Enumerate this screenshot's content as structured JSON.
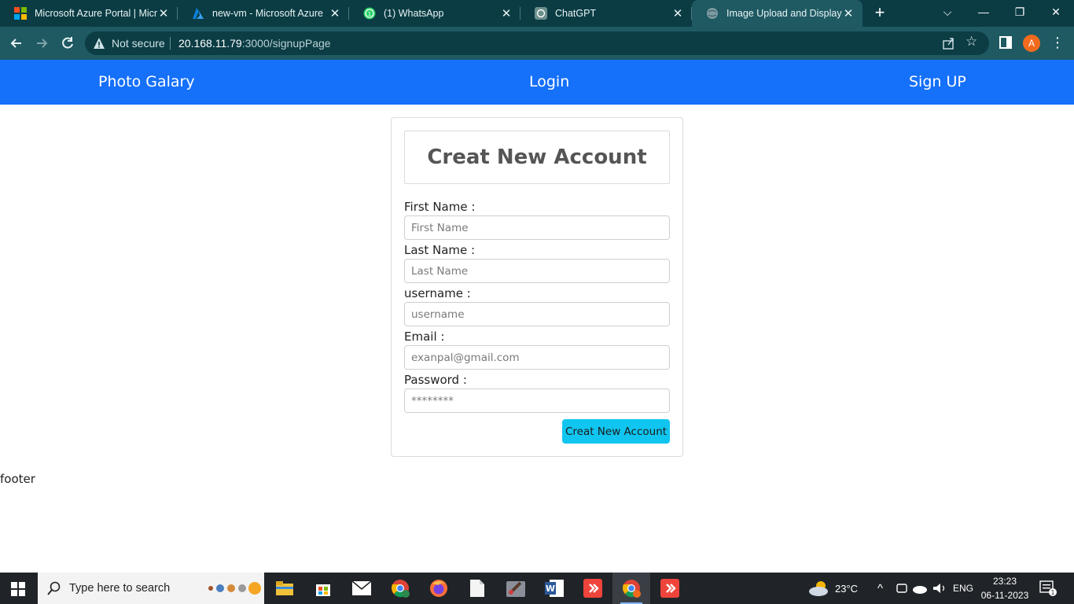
{
  "browser": {
    "tabs": [
      {
        "title": "Microsoft Azure Portal | Microsoft",
        "favicon": "microsoft-icon",
        "close": "✕"
      },
      {
        "title": "new-vm - Microsoft Azure",
        "favicon": "azure-icon",
        "close": "✕"
      },
      {
        "title": "(1) WhatsApp",
        "favicon": "whatsapp-icon",
        "badge": "1",
        "close": "✕"
      },
      {
        "title": "ChatGPT",
        "favicon": "chatgpt-icon",
        "close": "✕"
      },
      {
        "title": "Image Upload and Display",
        "favicon": "globe-icon",
        "close": "✕",
        "active": true
      }
    ],
    "new_tab": "+",
    "window_controls": {
      "dropdown": "⌵",
      "minimize": "—",
      "restore": "❐",
      "close": "✕"
    },
    "security_label": "Not secure",
    "url_host": "20.168.11.79",
    "url_rest": ":3000/signupPage",
    "profile_initial": "A"
  },
  "navbar": {
    "brand": "Photo Galary",
    "login": "Login",
    "signup": "Sign UP"
  },
  "form": {
    "title": "Creat New Account",
    "fields": [
      {
        "label": "First Name :",
        "placeholder": "First Name",
        "type": "text"
      },
      {
        "label": "Last Name :",
        "placeholder": "Last Name",
        "type": "text"
      },
      {
        "label": "username :",
        "placeholder": "username",
        "type": "text"
      },
      {
        "label": "Email :",
        "placeholder": "exanpal@gmail.com",
        "type": "email"
      },
      {
        "label": "Password :",
        "placeholder": "********",
        "type": "password"
      }
    ],
    "submit": "Creat New Account"
  },
  "footer": "footer",
  "taskbar": {
    "search_placeholder": "Type here to search",
    "pinned": [
      "file-explorer-icon",
      "store-icon",
      "mail-icon",
      "chrome-icon",
      "firefox-icon",
      "notepad-icon",
      "paint-icon",
      "word-icon",
      "anydesk-icon",
      "chrome-icon",
      "anydesk-icon"
    ],
    "weather": "23°C",
    "language": "ENG",
    "time": "23:23",
    "date": "06-11-2023",
    "notification_count": "1"
  },
  "colors": {
    "navbar": "#1570fa",
    "button": "#10c5ef",
    "chrome_tabstrip": "#0b3c44",
    "chrome_toolbar": "#1f5a63"
  }
}
